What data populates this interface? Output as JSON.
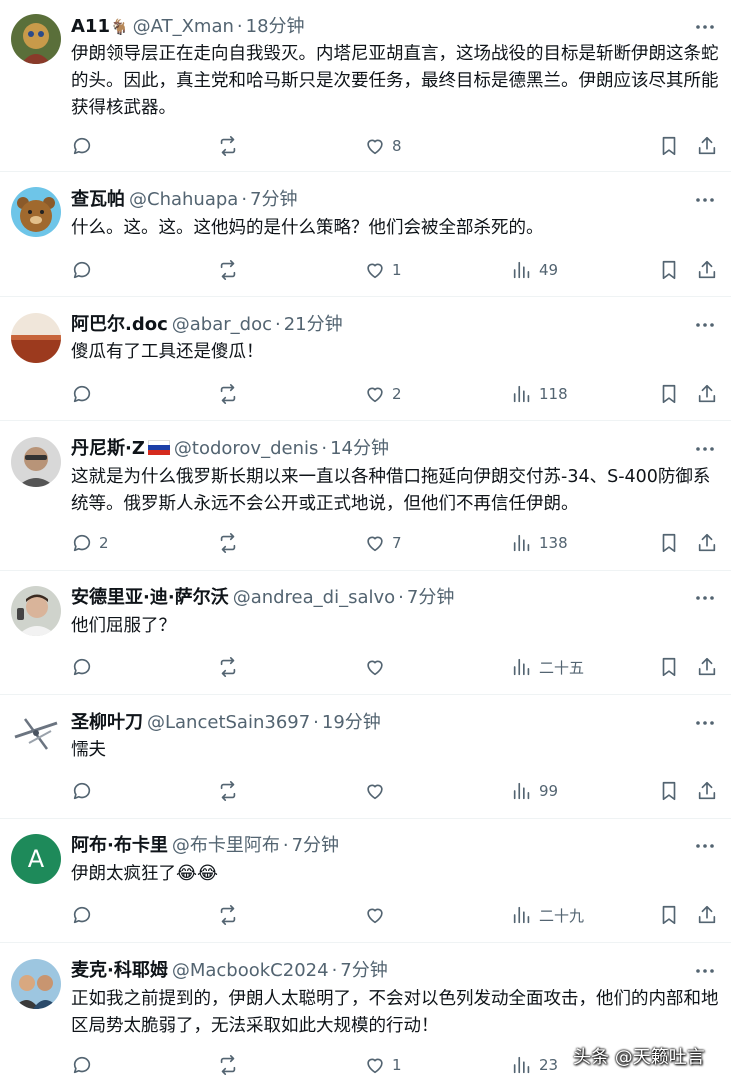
{
  "posts": [
    {
      "name": "A11",
      "badge": "🐐",
      "handle": "@AT_Xman",
      "time": "18分钟",
      "text": "伊朗领导层正在走向自我毁灭。内塔尼亚胡直言，这场战役的目标是斩断伊朗这条蛇的头。因此，真主党和哈马斯只是次要任务，最终目标是德黑兰。伊朗应该尽其所能获得核武器。",
      "replies": "",
      "reposts": "",
      "likes": "8",
      "views": ""
    },
    {
      "name": "查瓦帕",
      "badge": "",
      "handle": "@Chahuapa",
      "time": "7分钟",
      "text": "什么。这。这。这他妈的是什么策略？他们会被全部杀死的。",
      "replies": "",
      "reposts": "",
      "likes": "1",
      "views": "49"
    },
    {
      "name": "阿巴尔.doc",
      "badge": "",
      "handle": "@abar_doc",
      "time": "21分钟",
      "text": "傻瓜有了工具还是傻瓜！",
      "replies": "",
      "reposts": "",
      "likes": "2",
      "views": "118"
    },
    {
      "name": "丹尼斯·Z",
      "badge": "",
      "handle": "@todorov_denis",
      "time": "14分钟",
      "text": "这就是为什么俄罗斯长期以来一直以各种借口拖延向伊朗交付苏-34、S-400防御系统等。俄罗斯人永远不会公开或正式地说，但他们不再信任伊朗。",
      "replies": "2",
      "reposts": "",
      "likes": "7",
      "views": "138"
    },
    {
      "name": "安德里亚·迪·萨尔沃",
      "badge": "",
      "handle": "@andrea_di_salvo",
      "time": "7分钟",
      "text": "他们屈服了？",
      "replies": "",
      "reposts": "",
      "likes": "",
      "views": "二十五"
    },
    {
      "name": "圣柳叶刀",
      "badge": "",
      "handle": "@LancetSain3697",
      "time": "19分钟",
      "text": "懦夫",
      "replies": "",
      "reposts": "",
      "likes": "",
      "views": "99"
    },
    {
      "name": "阿布·布卡里",
      "badge": "",
      "handle": "@布卡里阿布",
      "time": "7分钟",
      "text": "伊朗太疯狂了",
      "emoji": "😂😂",
      "avatar_letter": "A",
      "replies": "",
      "reposts": "",
      "likes": "",
      "views": "二十九"
    },
    {
      "name": "麦克·科耶姆",
      "badge": "",
      "handle": "@MacbookC2024",
      "time": "7分钟",
      "text": "正如我之前提到的，伊朗人太聪明了，不会对以色列发动全面攻击，他们的内部和地区局势太脆弱了，无法采取如此大规模的行动！",
      "replies": "",
      "reposts": "",
      "likes": "1",
      "views": "23"
    }
  ],
  "separator": "·",
  "watermark": "头条 @天籁吐言",
  "colors": {
    "text": "#0f1419",
    "secondary": "#536471",
    "avatar_green": "#1e8a5a",
    "border": "#eff3f4"
  },
  "icons": [
    "reply-icon",
    "repost-icon",
    "like-icon",
    "views-icon",
    "bookmark-icon",
    "share-icon",
    "more-icon"
  ]
}
